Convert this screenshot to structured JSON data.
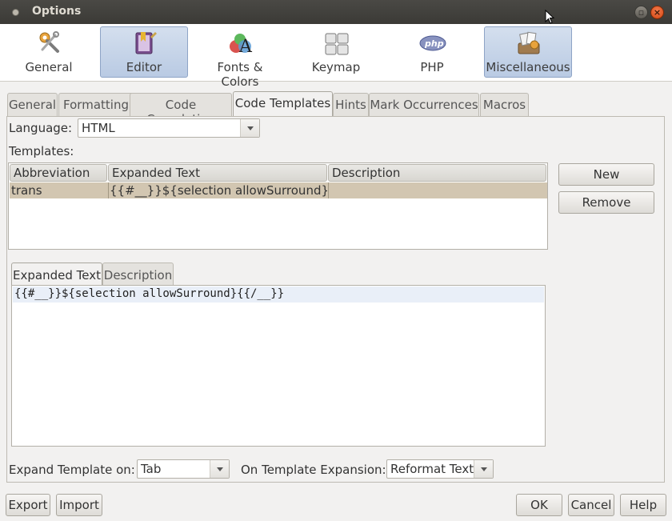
{
  "window": {
    "title": "Options"
  },
  "categories": [
    {
      "label": "General",
      "icon": "tools-icon",
      "selected": false
    },
    {
      "label": "Editor",
      "icon": "editor-icon",
      "selected": true
    },
    {
      "label": "Fonts & Colors",
      "icon": "fonts-colors-icon",
      "selected": false
    },
    {
      "label": "Keymap",
      "icon": "keyboard-icon",
      "selected": false
    },
    {
      "label": "PHP",
      "icon": "php-icon",
      "selected": false
    },
    {
      "label": "Miscellaneous",
      "icon": "misc-icon",
      "selected": true
    }
  ],
  "tabs": [
    {
      "label": "General"
    },
    {
      "label": "Formatting"
    },
    {
      "label": "Code Completion"
    },
    {
      "label": "Code Templates",
      "selected": true
    },
    {
      "label": "Hints"
    },
    {
      "label": "Mark Occurrences"
    },
    {
      "label": "Macros"
    }
  ],
  "language": {
    "label": "Language:",
    "value": "HTML"
  },
  "templates": {
    "label": "Templates:",
    "columns": [
      "Abbreviation",
      "Expanded Text",
      "Description"
    ],
    "rows": [
      {
        "abbreviation": "trans",
        "expanded": "{{#__}}${selection allowSurround}{{/_...",
        "description": ""
      }
    ]
  },
  "buttons": {
    "new": "New",
    "remove": "Remove"
  },
  "inner_tabs": [
    {
      "label": "Expanded Text",
      "selected": true
    },
    {
      "label": "Description"
    }
  ],
  "editor": {
    "text": "{{#__}}${selection allowSurround}{{/__}}"
  },
  "expand": {
    "label": "Expand Template on:",
    "value": "Tab",
    "on_expansion_label": "On Template Expansion:",
    "on_expansion_value": "Reformat Text"
  },
  "footer": {
    "export": "Export",
    "import": "Import",
    "ok": "OK",
    "cancel": "Cancel",
    "help": "Help"
  },
  "colors": {
    "selected_row": "#d2c6b1",
    "selected_category": "#b9cae3",
    "close_button": "#e0531a"
  }
}
